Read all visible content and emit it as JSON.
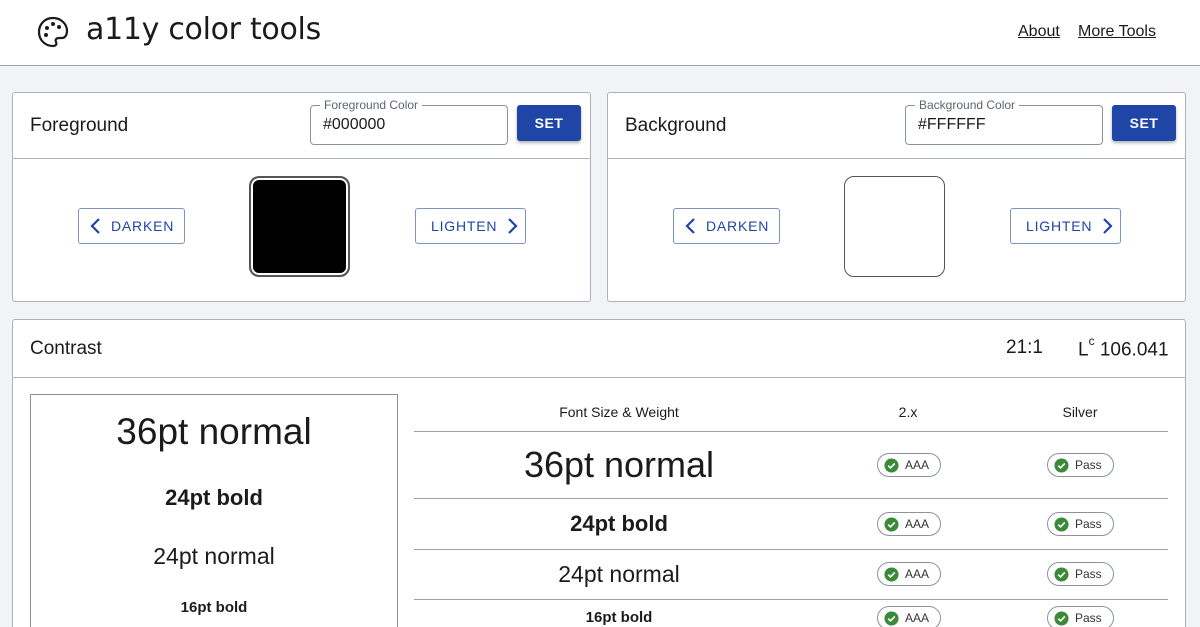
{
  "header": {
    "brand": "a11y color tools",
    "nav": {
      "about": "About",
      "more_tools": "More Tools"
    },
    "logo_icon": "palette-icon"
  },
  "foreground": {
    "title": "Foreground",
    "field_label": "Foreground Color",
    "value": "#000000",
    "set_label": "SET",
    "darken_label": "DARKEN",
    "lighten_label": "LIGHTEN",
    "swatch_color": "#000000"
  },
  "background": {
    "title": "Background",
    "field_label": "Background Color",
    "value": "#FFFFFF",
    "set_label": "SET",
    "darken_label": "DARKEN",
    "lighten_label": "LIGHTEN",
    "swatch_color": "#FFFFFF"
  },
  "contrast": {
    "title": "Contrast",
    "ratio": "21:1",
    "lc_letter": "L",
    "lc_sup": "c",
    "lc_value": "106.041"
  },
  "preview": {
    "items": [
      "36pt normal",
      "24pt bold",
      "24pt normal",
      "16pt bold"
    ]
  },
  "table": {
    "headers": {
      "font": "Font Size & Weight",
      "v2": "2.x",
      "silver": "Silver"
    },
    "rows": [
      {
        "label": "36pt normal",
        "v2": "AAA",
        "silver": "Pass"
      },
      {
        "label": "24pt bold",
        "v2": "AAA",
        "silver": "Pass"
      },
      {
        "label": "24pt normal",
        "v2": "AAA",
        "silver": "Pass"
      },
      {
        "label": "16pt bold",
        "v2": "AAA",
        "silver": "Pass"
      }
    ]
  },
  "colors": {
    "accent": "#1f45a6",
    "pass_green": "#3a8a3a",
    "border": "#aab2bb",
    "page_bg": "#f1f3f6"
  }
}
